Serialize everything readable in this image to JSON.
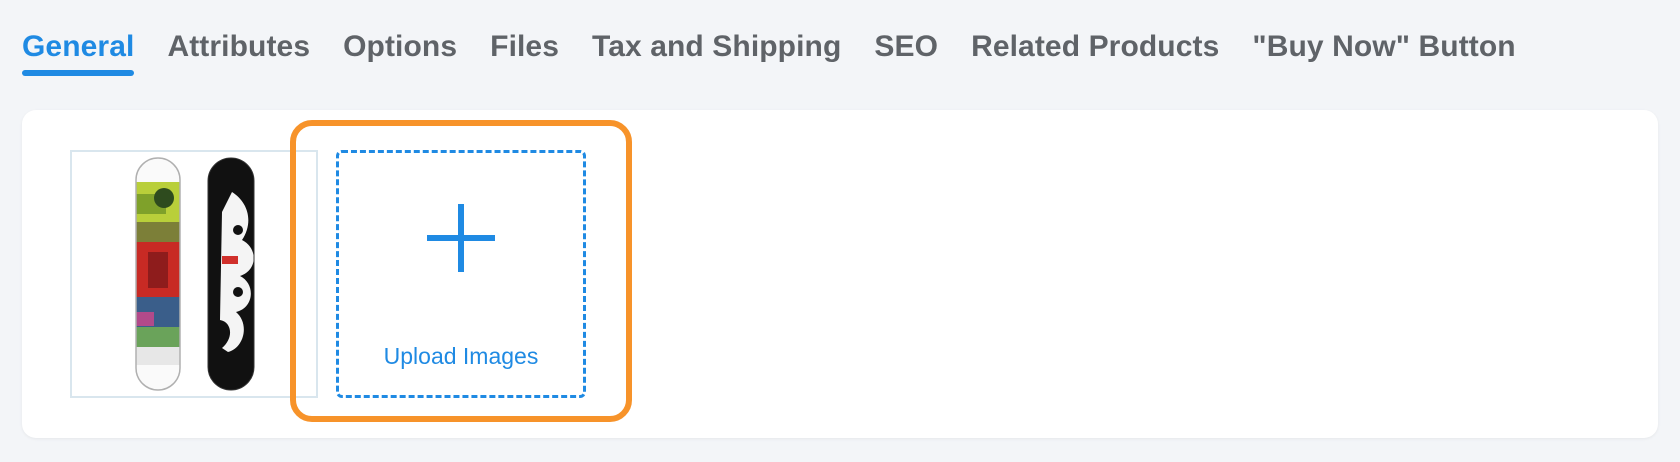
{
  "tabs": [
    {
      "label": "General",
      "active": true
    },
    {
      "label": "Attributes",
      "active": false
    },
    {
      "label": "Options",
      "active": false
    },
    {
      "label": "Files",
      "active": false
    },
    {
      "label": "Tax and Shipping",
      "active": false
    },
    {
      "label": "SEO",
      "active": false
    },
    {
      "label": "Related Products",
      "active": false
    },
    {
      "label": "\"Buy Now\" Button",
      "active": false
    }
  ],
  "images": {
    "thumbnail_icon": "snowboard-image",
    "upload_label": "Upload Images",
    "upload_icon": "plus-icon"
  },
  "colors": {
    "accent": "#1f8ae3",
    "highlight": "#f7932a",
    "tab_inactive": "#5f6368",
    "page_bg": "#f3f5f8"
  }
}
